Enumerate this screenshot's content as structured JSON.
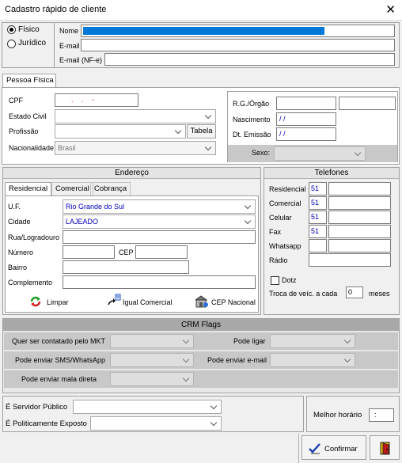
{
  "window": {
    "title": "Cadastro rápido de cliente",
    "close": "✕"
  },
  "person_type": {
    "fisico": "Físico",
    "juridico": "Jurídico"
  },
  "identity": {
    "nome_label": "Nome",
    "email_label": "E-mail",
    "email_nfe_label": "E-mail (NF-e)"
  },
  "pf_tab": "Pessoa Física",
  "pf": {
    "cpf_label": "CPF",
    "cpf_mask": ".  .  -",
    "estado_civil_label": "Estado Civil",
    "profissao_label": "Profissão",
    "tabela_button": "Tabela",
    "nacionalidade_label": "Nacionalidade",
    "nacionalidade_value": "Brasil",
    "rg_label": "R.G./Órgão",
    "nascimento_label": "Nascimento",
    "nascimento_value": "/ /",
    "emissao_label": "Dt. Emissão",
    "emissao_value": "/ /",
    "sexo_label": "Sexo:"
  },
  "endereco": {
    "header": "Endereço",
    "tabs": [
      "Residencial",
      "Comercial",
      "Cobrança"
    ],
    "uf_label": "U.F.",
    "uf_value": "Rio Grande do Sul",
    "cidade_label": "Cidade",
    "cidade_value": "LAJEADO",
    "rua_label": "Rua/Logradouro",
    "numero_label": "Número",
    "cep_label": "CEP",
    "bairro_label": "Bairro",
    "complemento_label": "Complemento",
    "limpar_button": "Limpar",
    "igual_comercial_button": "Igual Comercial",
    "cep_nacional_button": "CEP Nacional"
  },
  "telefones": {
    "header": "Telefones",
    "residencial_label": "Residencial",
    "residencial_ddd": "51",
    "comercial_label": "Comercial",
    "comercial_ddd": "51",
    "celular_label": "Celular",
    "celular_ddd": "51",
    "fax_label": "Fax",
    "fax_ddd": "51",
    "whatsapp_label": "Whatsapp",
    "radio_label": "Rádio",
    "dotz_label": "Dotz",
    "troca_label": "Troca de veíc. a cada",
    "troca_value": "0",
    "meses_label": "meses"
  },
  "crm": {
    "header": "CRM Flags",
    "contato_mkt": "Quer ser contatado pelo MKT",
    "pode_ligar": "Pode ligar",
    "sms_whatsapp": "Pode enviar SMS/WhatsApp",
    "pode_email": "Pode enviar e-mail",
    "mala_direta": "Pode enviar mala direta"
  },
  "bottom": {
    "servidor_label": "É Servidor Público",
    "politico_label": "É Politicamente Exposto",
    "horario_label": "Melhor horário",
    "horario_value": ":",
    "confirmar_button": "Confirmar"
  }
}
